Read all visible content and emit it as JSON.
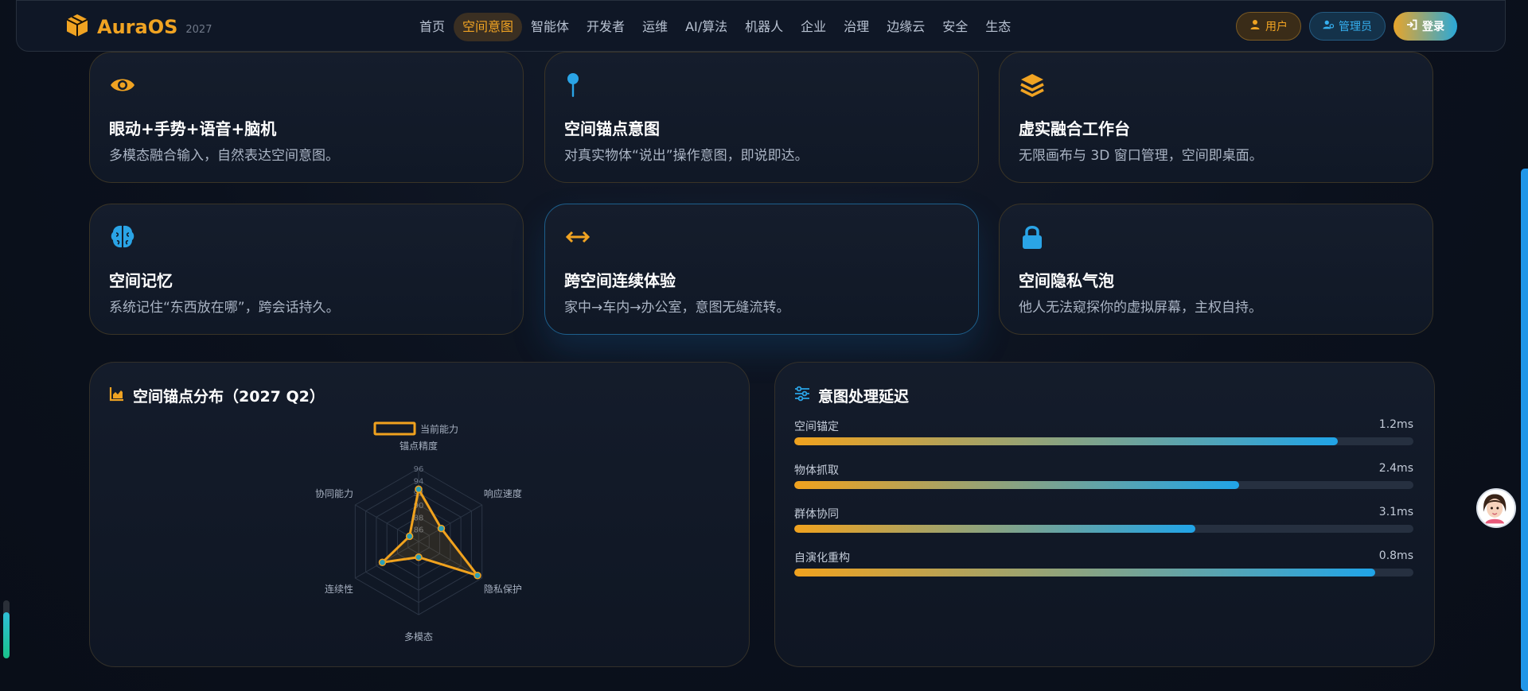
{
  "brand": {
    "name": "AuraOS",
    "year": "2027",
    "icon": "cube-icon"
  },
  "nav": {
    "items": [
      {
        "label": "首页"
      },
      {
        "label": "空间意图",
        "active": true
      },
      {
        "label": "智能体"
      },
      {
        "label": "开发者"
      },
      {
        "label": "运维"
      },
      {
        "label": "AI/算法"
      },
      {
        "label": "机器人"
      },
      {
        "label": "企业"
      },
      {
        "label": "治理"
      },
      {
        "label": "边缘云"
      },
      {
        "label": "安全"
      },
      {
        "label": "生态"
      }
    ],
    "user_label": "用户",
    "admin_label": "管理员",
    "login_label": "登录"
  },
  "features": [
    {
      "icon": "eye-icon",
      "title": "眼动+手势+语音+脑机",
      "desc": "多模态融合输入，自然表达空间意图。"
    },
    {
      "icon": "map-pin-icon",
      "title": "空间锚点意图",
      "desc": "对真实物体“说出”操作意图，即说即达。"
    },
    {
      "icon": "layers-icon",
      "title": "虚实融合工作台",
      "desc": "无限画布与 3D 窗口管理，空间即桌面。"
    },
    {
      "icon": "brain-icon",
      "title": "空间记忆",
      "desc": "系统记住“东西放在哪”，跨会话持久。"
    },
    {
      "icon": "arrows-horizontal-icon",
      "title": "跨空间连续体验",
      "desc": "家中→车内→办公室，意图无缝流转。"
    },
    {
      "icon": "lock-icon",
      "title": "空间隐私气泡",
      "desc": "他人无法窥探你的虚拟屏幕，主权自持。"
    }
  ],
  "radar_panel": {
    "title": "空间锚点分布（2027 Q2）",
    "icon": "area-chart-icon"
  },
  "chart_data": {
    "type": "radar",
    "legend": [
      "当前能力"
    ],
    "axes": [
      "锚点精度",
      "响应速度",
      "隐私保护",
      "多模态",
      "连续性",
      "协同能力"
    ],
    "tick_labels": [
      "96",
      "94",
      "92",
      "90",
      "88",
      "86"
    ],
    "series": [
      {
        "name": "当前能力",
        "values": [
          94,
          89,
          97,
          87,
          92,
          86
        ]
      }
    ],
    "range": [
      84,
      98
    ],
    "color": "#f0a21e"
  },
  "latency_panel": {
    "title": "意图处理延迟",
    "icon": "sliders-icon",
    "rows": [
      {
        "label": "空间锚定",
        "value": "1.2ms",
        "fraction": 0.878
      },
      {
        "label": "物体抓取",
        "value": "2.4ms",
        "fraction": 0.718
      },
      {
        "label": "群体协同",
        "value": "3.1ms",
        "fraction": 0.648
      },
      {
        "label": "自演化重构",
        "value": "0.8ms",
        "fraction": 0.938
      }
    ]
  },
  "side": {
    "assistant_icon": "assistant-avatar-icon",
    "level_fraction": 0.8
  },
  "colors": {
    "accent": "#f0a322",
    "blue": "#20a4e8"
  }
}
